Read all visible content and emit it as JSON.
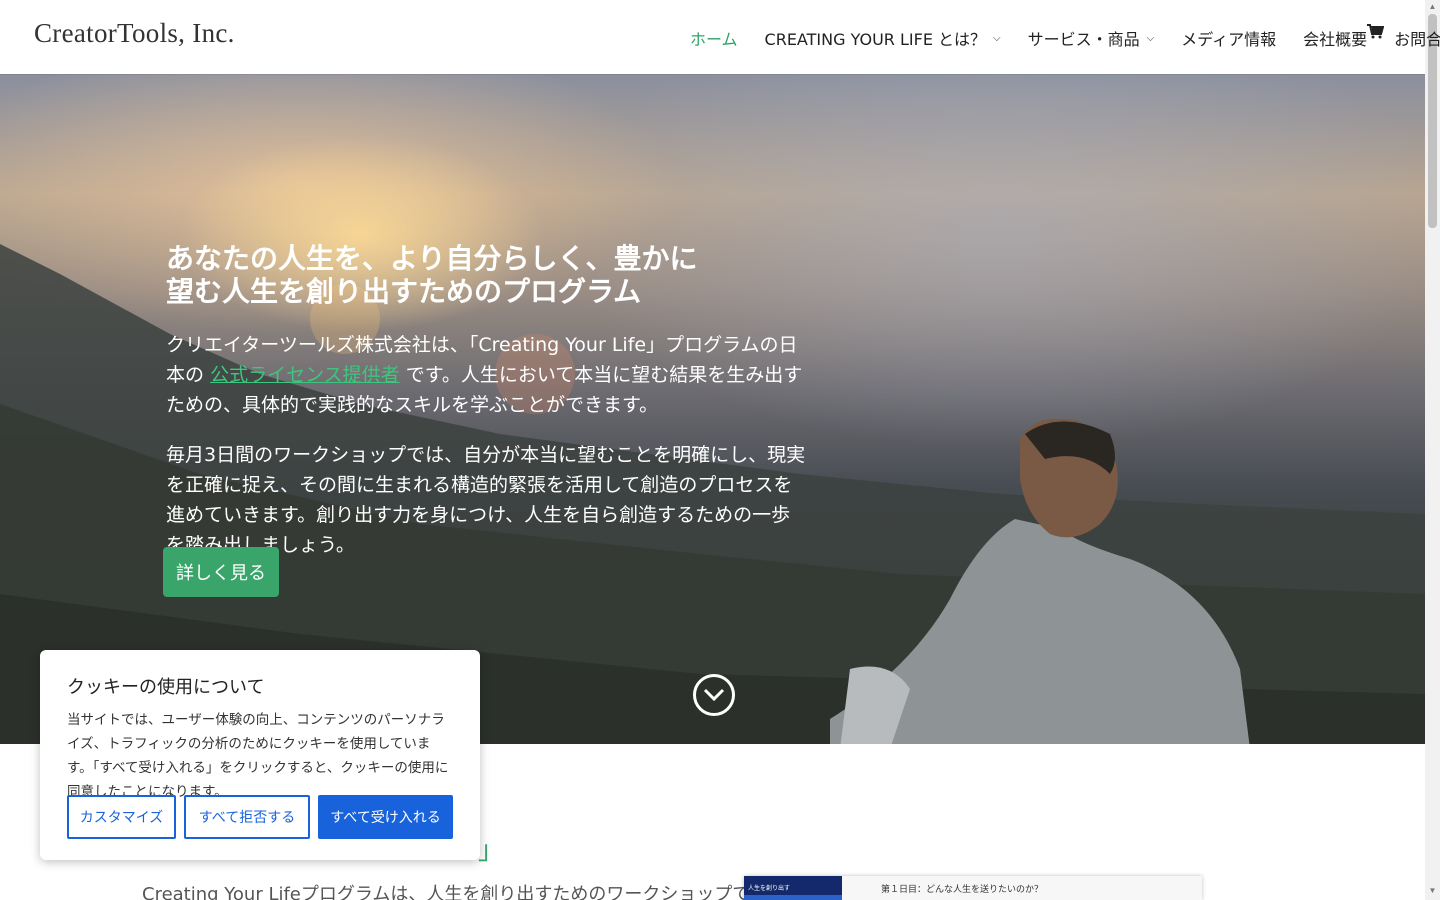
{
  "header": {
    "logo": "CreatorTools, Inc.",
    "nav": [
      {
        "label": "ホーム",
        "active": true,
        "dropdown": false
      },
      {
        "label": "CREATING YOUR LIFE とは？",
        "active": false,
        "dropdown": true
      },
      {
        "label": "サービス・商品",
        "active": false,
        "dropdown": true
      },
      {
        "label": "メディア情報",
        "active": false,
        "dropdown": true
      },
      {
        "label": "会社概要",
        "active": false,
        "dropdown": false
      },
      {
        "label": "お問合せ",
        "active": false,
        "dropdown": false
      }
    ],
    "cart_icon": "cart-icon"
  },
  "hero": {
    "title_line1": "あなたの人生を、より自分らしく、豊かに",
    "title_line2": "望む人生を創り出すためのプログラム",
    "p1_before": "クリエイターツールズ株式会社は、「Creating Your Life」プログラムの日本の",
    "p1_link": "公式ライセンス提供者",
    "p1_after": "です。人生において本当に望む結果を生み出すための、具体的で実践的なスキルを学ぶことができます。",
    "p2": "毎月3日間のワークショップでは、自分が本当に望むことを明確にし、現実を正確に捉え、その間に生まれる構造的緊張を活用して創造のプロセスを進めていきます。創り出す力を身につけ、人生を自ら創造するための一歩を踏み出しましょう。",
    "cta": "詳しく見る"
  },
  "section": {
    "title_mark": "」",
    "text": "Creating Your Lifeプログラムは、人生を創り出すためのワークショップです。",
    "preview_side": "人生を創り出す",
    "preview_title": "第１日目：どんな人生を送りたいのか？"
  },
  "cookie": {
    "title": "クッキーの使用について",
    "body": "当サイトでは、ユーザー体験の向上、コンテンツのパーソナライズ、トラフィックの分析のためにクッキーを使用しています。「すべて受け入れる」をクリックすると、クッキーの使用に同意したことになります。",
    "customize": "カスタマイズ",
    "reject": "すべて拒否する",
    "accept": "すべて受け入れる"
  }
}
